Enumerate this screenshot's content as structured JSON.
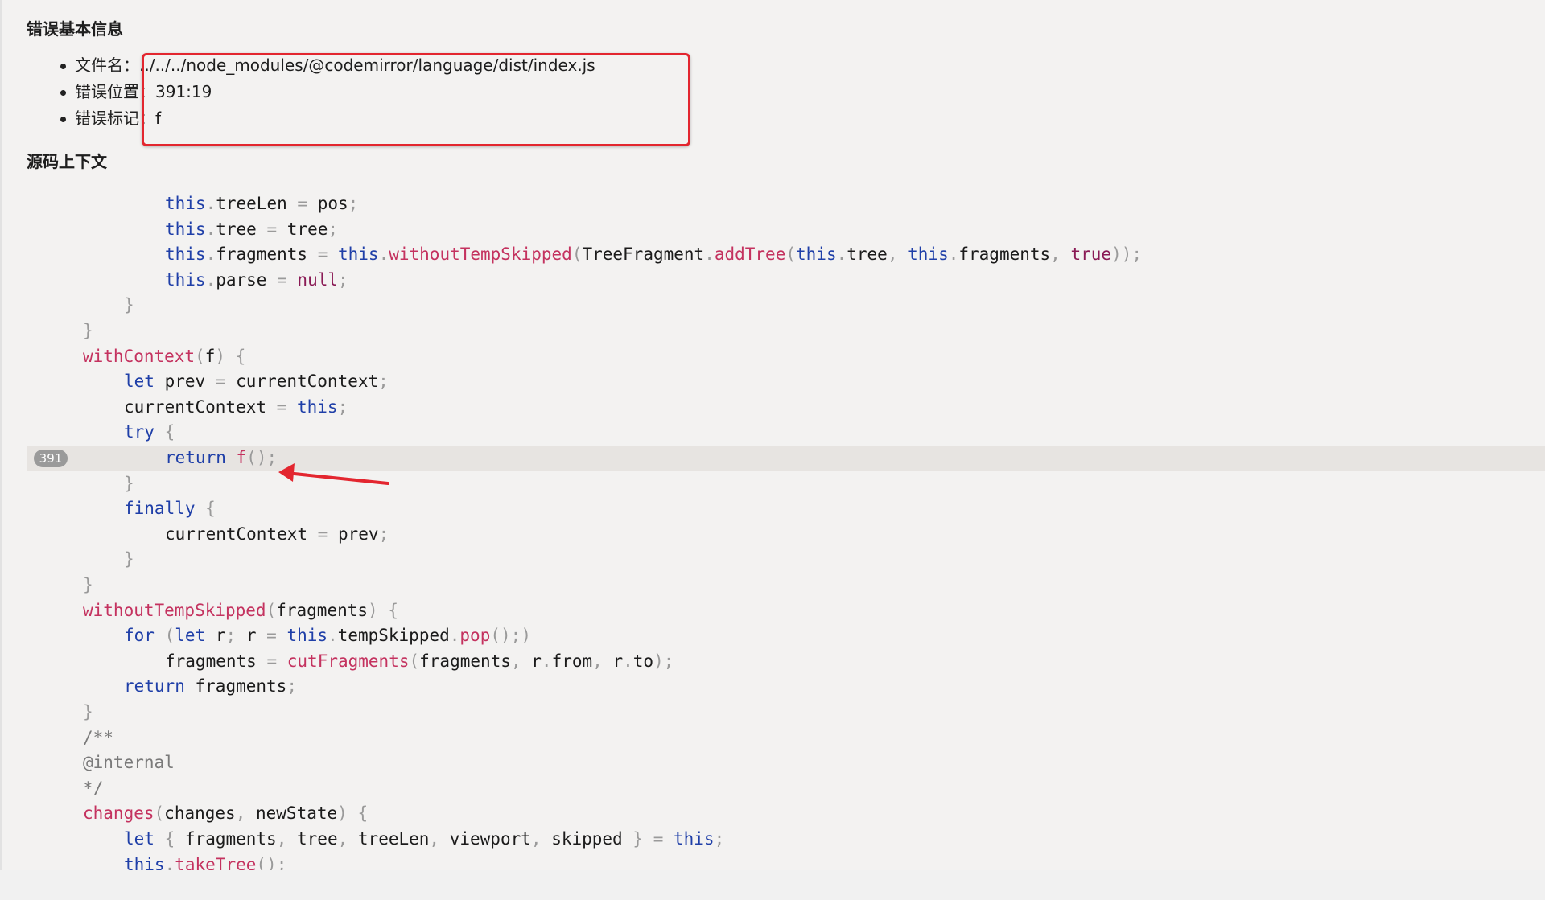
{
  "error_info": {
    "title": "错误基本信息",
    "items": [
      {
        "label": "文件名：",
        "value": "../../../node_modules/@codemirror/language/dist/index.js"
      },
      {
        "label": "错误位置：",
        "value": "391:19"
      },
      {
        "label": "错误标记：",
        "value": "f"
      }
    ]
  },
  "source": {
    "title": "源码上下文",
    "error_line_number": "391",
    "code_font": "monospace",
    "lines": [
      "this.treeLen = pos;",
      "this.tree = tree;",
      "this.fragments = this.withoutTempSkipped(TreeFragment.addTree(this.tree, this.fragments, true));",
      "this.parse = null;",
      "}",
      "}",
      "withContext(f) {",
      "let prev = currentContext;",
      "currentContext = this;",
      "try {",
      "return f();",
      "}",
      "finally {",
      "currentContext = prev;",
      "}",
      "}",
      "withoutTempSkipped(fragments) {",
      "for (let r; r = this.tempSkipped.pop();)",
      "fragments = cutFragments(fragments, r.from, r.to);",
      "return fragments;",
      "}",
      "/**",
      "@internal",
      "*/",
      "changes(changes, newState) {",
      "let { fragments, tree, treeLen, viewport, skipped } = this;",
      "this.takeTree();"
    ]
  },
  "colors": {
    "highlight_box": "#e3262f",
    "arrow": "#e3262f",
    "keyword": "#1f3fa8",
    "function": "#c4325f",
    "literal": "#8a1a55"
  }
}
